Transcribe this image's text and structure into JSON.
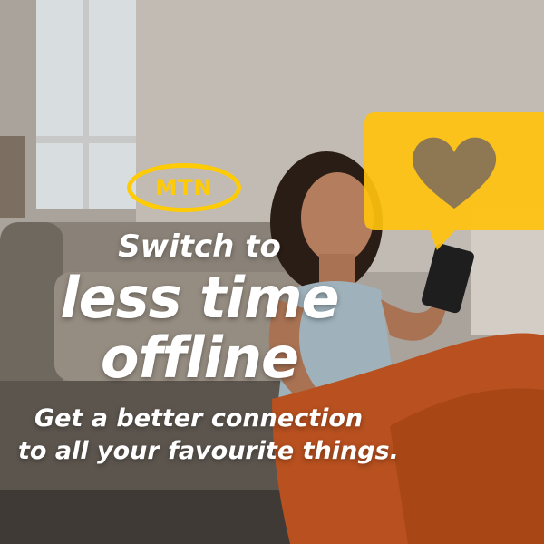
{
  "brand": {
    "logo_text": "MTN",
    "logo_color": "#ffcb05"
  },
  "headline": {
    "line1": "Switch to",
    "line2": "less time",
    "line3": "offline"
  },
  "subheadline": {
    "line1": "Get a better connection",
    "line2": "to all your favourite things."
  },
  "badge": {
    "icon": "heart-icon",
    "color": "#ffc20e"
  },
  "colors": {
    "text": "#ffffff",
    "accent": "#ffcb05"
  }
}
